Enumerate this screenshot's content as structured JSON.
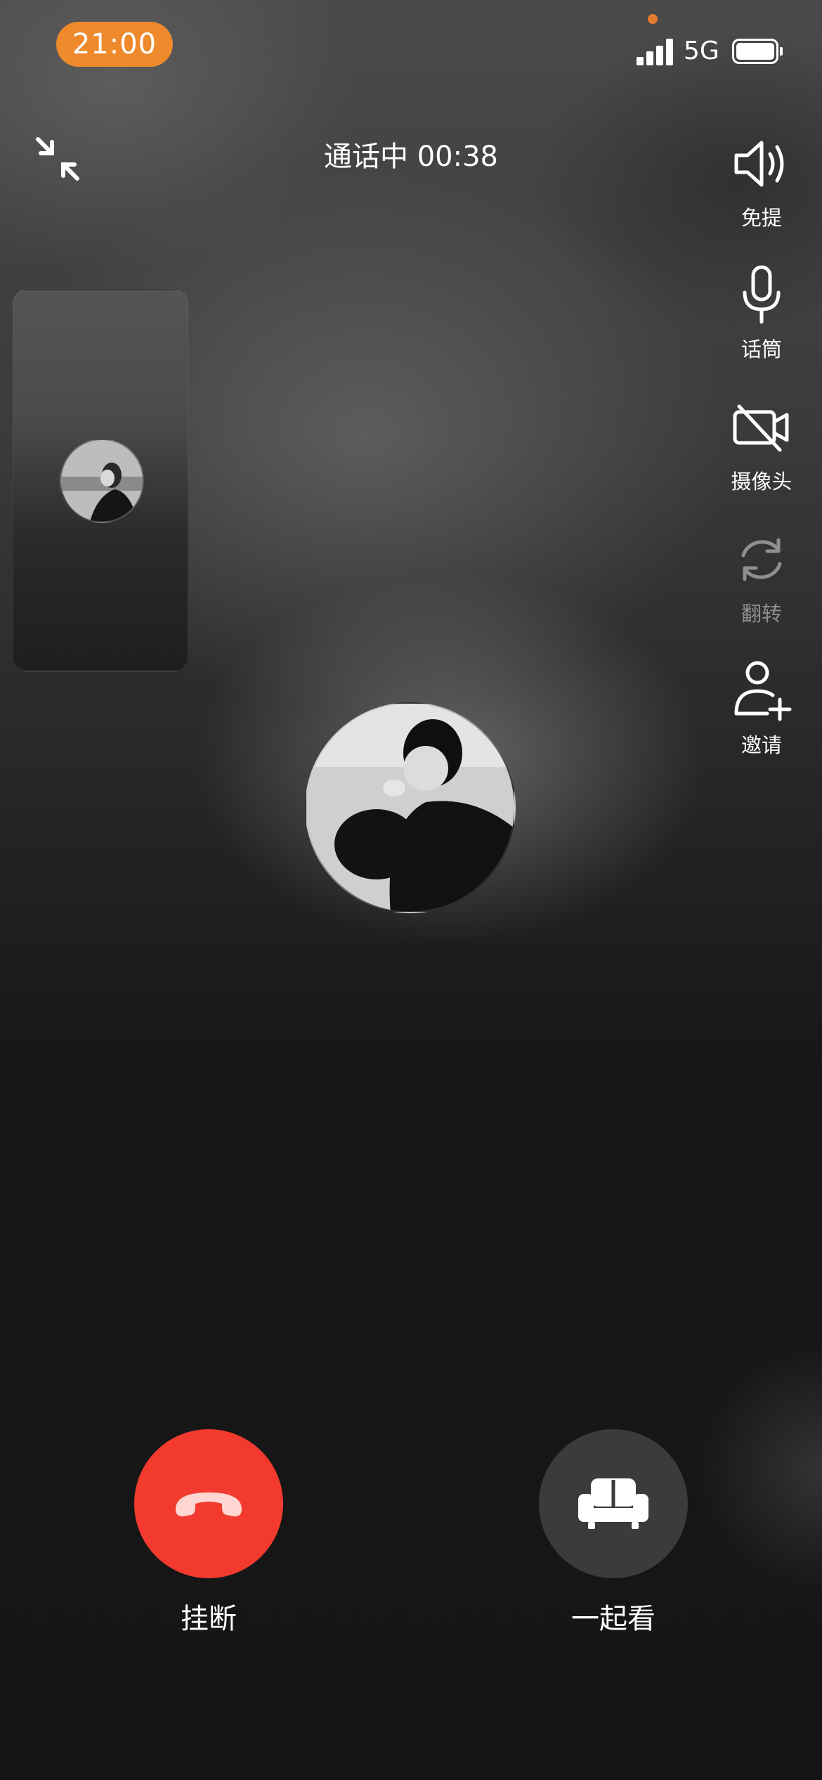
{
  "status_bar": {
    "time": "21:00",
    "network": "5G"
  },
  "header": {
    "call_status": "通话中 00:38"
  },
  "side_controls": [
    {
      "label": "免提",
      "icon": "speaker-icon",
      "enabled": true
    },
    {
      "label": "话筒",
      "icon": "microphone-icon",
      "enabled": true
    },
    {
      "label": "摄像头",
      "icon": "camera-off-icon",
      "enabled": true
    },
    {
      "label": "翻转",
      "icon": "flip-camera-icon",
      "enabled": false
    },
    {
      "label": "邀请",
      "icon": "add-user-icon",
      "enabled": true
    }
  ],
  "bottom_actions": {
    "hangup_label": "挂断",
    "watch_together_label": "一起看"
  },
  "colors": {
    "time_pill": "#ee8a2c",
    "hangup": "#f23a2f",
    "watch_button": "#3b3b3b"
  }
}
